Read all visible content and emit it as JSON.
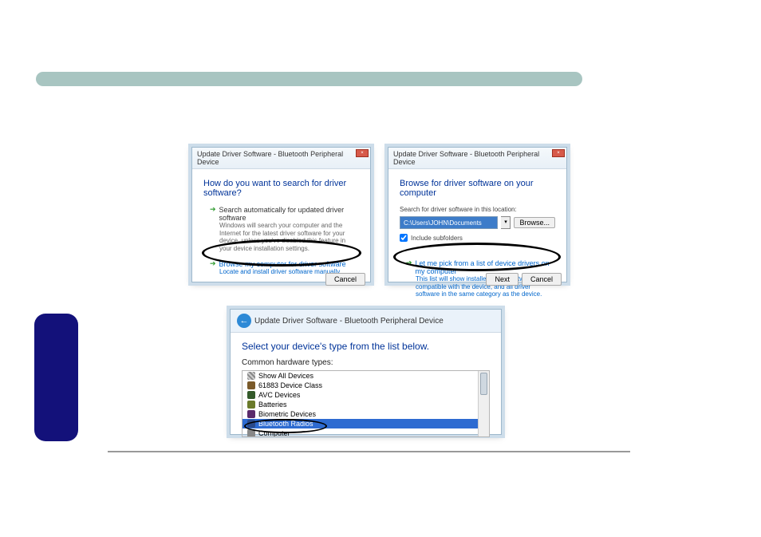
{
  "colors": {
    "accent": "#003399",
    "link": "#0066cc",
    "barBg": "#a8c5c1",
    "tabBg": "#13117a"
  },
  "d1": {
    "title": "Update Driver Software - Bluetooth Peripheral Device",
    "heading": "How do you want to search for driver software?",
    "opt1": {
      "title": "Search automatically for updated driver software",
      "desc": "Windows will search your computer and the Internet for the latest driver software for your device, unless you've disabled this feature in your device installation settings."
    },
    "opt2": {
      "title": "Browse my computer for driver software",
      "desc": "Locate and install driver software manually."
    },
    "cancel": "Cancel"
  },
  "d2": {
    "title": "Update Driver Software - Bluetooth Peripheral Device",
    "heading": "Browse for driver software on your computer",
    "searchLabel": "Search for driver software in this location:",
    "path": "C:\\Users\\JOHN\\Documents",
    "browse": "Browse...",
    "include": "Include subfolders",
    "pick": {
      "title": "Let me pick from a list of device drivers on my computer",
      "desc": "This list will show installed driver software compatible with the device, and all driver software in the same category as the device."
    },
    "next": "Next",
    "cancel": "Cancel"
  },
  "d3": {
    "title": "Update Driver Software - Bluetooth Peripheral Device",
    "heading": "Select your device's type from the list below.",
    "subheader": "Common hardware types:",
    "items": [
      {
        "label": "Show All Devices",
        "icon": "ic-show"
      },
      {
        "label": "61883 Device Class",
        "icon": "ic-1394"
      },
      {
        "label": "AVC Devices",
        "icon": "ic-avc"
      },
      {
        "label": "Batteries",
        "icon": "ic-bat"
      },
      {
        "label": "Biometric Devices",
        "icon": "ic-bio"
      },
      {
        "label": "Bluetooth Radios",
        "icon": "ic-bt",
        "selected": true
      },
      {
        "label": "Computer",
        "icon": "ic-comp"
      }
    ]
  }
}
